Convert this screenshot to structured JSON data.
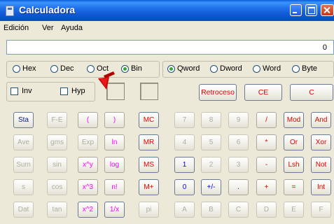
{
  "window": {
    "title": "Calculadora"
  },
  "menu": [
    "Edición",
    "Ver",
    "Ayuda"
  ],
  "display": {
    "value": "0"
  },
  "base_modes": [
    {
      "label": "Hex",
      "selected": false
    },
    {
      "label": "Dec",
      "selected": false
    },
    {
      "label": "Oct",
      "selected": false
    },
    {
      "label": "Bin",
      "selected": true
    }
  ],
  "word_sizes": [
    {
      "label": "Qword",
      "selected": true
    },
    {
      "label": "Dword",
      "selected": false
    },
    {
      "label": "Word",
      "selected": false
    },
    {
      "label": "Byte",
      "selected": false
    }
  ],
  "checkboxes": [
    {
      "label": "Inv",
      "checked": false
    },
    {
      "label": "Hyp",
      "checked": false
    }
  ],
  "edit_buttons": [
    "Retroceso",
    "CE",
    "C"
  ],
  "keys": [
    [
      "Sta",
      "F-E",
      "(",
      ")",
      "MC",
      "7",
      "8",
      "9",
      "/",
      "Mod",
      "And"
    ],
    [
      "Ave",
      "gms",
      "Exp",
      "ln",
      "MR",
      "4",
      "5",
      "6",
      "*",
      "Or",
      "Xor"
    ],
    [
      "Sum",
      "sin",
      "x^y",
      "log",
      "MS",
      "1",
      "2",
      "3",
      "-",
      "Lsh",
      "Not"
    ],
    [
      "s",
      "cos",
      "x^3",
      "n!",
      "M+",
      "0",
      "+/-",
      ".",
      "+",
      "=",
      "Int"
    ],
    [
      "Dat",
      "tan",
      "x^2",
      "1/x",
      "pi",
      "A",
      "B",
      "C",
      "D",
      "E",
      "F"
    ]
  ],
  "colors": {
    "title_bar": "#1f6fe8",
    "menu_background": "#ece9d8",
    "key_blue": "#0000ff",
    "key_red": "#e00000",
    "key_magenta": "#ff00ff",
    "key_disabled": "#b0ad9e",
    "radio_selected": "#3ba53b"
  }
}
